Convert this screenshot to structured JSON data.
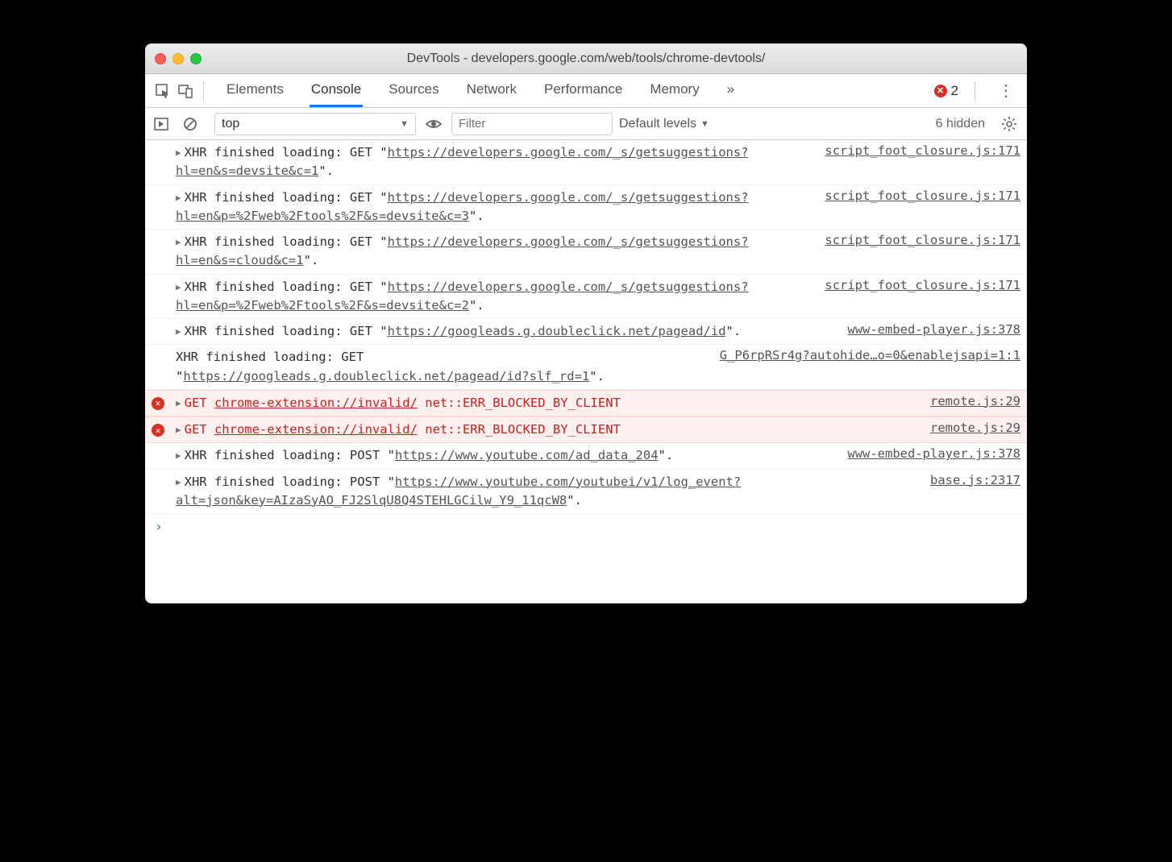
{
  "window": {
    "title": "DevTools - developers.google.com/web/tools/chrome-devtools/"
  },
  "tabs": {
    "items": [
      "Elements",
      "Console",
      "Sources",
      "Network",
      "Performance",
      "Memory"
    ],
    "activeIndex": 1,
    "overflow": "»",
    "errorCount": "2"
  },
  "filterbar": {
    "context": "top",
    "contextArrow": "▼",
    "filterPlaceholder": "Filter",
    "levels": "Default levels",
    "levelsArrow": "▼",
    "hidden": "6 hidden"
  },
  "rows": [
    {
      "type": "xhr",
      "prefix": "XHR finished loading: GET \"",
      "url": "https://developers.google.com/_s/getsuggestions?hl=en&s=devsite&c=1",
      "suffix": "\".",
      "src": "script_foot_closure.js:171",
      "expand": true
    },
    {
      "type": "xhr",
      "prefix": "XHR finished loading: GET \"",
      "url": "https://developers.google.com/_s/getsuggestions?hl=en&p=%2Fweb%2Ftools%2F&s=devsite&c=3",
      "suffix": "\".",
      "src": "script_foot_closure.js:171",
      "expand": true
    },
    {
      "type": "xhr",
      "prefix": "XHR finished loading: GET \"",
      "url": "https://developers.google.com/_s/getsuggestions?hl=en&s=cloud&c=1",
      "suffix": "\".",
      "src": "script_foot_closure.js:171",
      "expand": true
    },
    {
      "type": "xhr",
      "prefix": "XHR finished loading: GET \"",
      "url": "https://developers.google.com/_s/getsuggestions?hl=en&p=%2Fweb%2Ftools%2F&s=devsite&c=2",
      "suffix": "\".",
      "src": "script_foot_closure.js:171",
      "expand": true
    },
    {
      "type": "xhr",
      "prefix": "XHR finished loading: GET \"",
      "url": "https://googleads.g.doubleclick.net/pagead/id",
      "suffix": "\".",
      "src": "www-embed-player.js:378",
      "expand": true
    },
    {
      "type": "xhr",
      "prefix": "XHR finished loading: GET \"",
      "url": "https://googleads.g.doubleclick.net/pagead/id?slf_rd=1",
      "suffix": "\".",
      "src": "G_P6rpRSr4g?autohide…o=0&enablejsapi=1:1",
      "expand": false
    },
    {
      "type": "error",
      "method": "GET",
      "url": "chrome-extension://invalid/",
      "err": "net::ERR_BLOCKED_BY_CLIENT",
      "src": "remote.js:29",
      "expand": true
    },
    {
      "type": "error",
      "method": "GET",
      "url": "chrome-extension://invalid/",
      "err": "net::ERR_BLOCKED_BY_CLIENT",
      "src": "remote.js:29",
      "expand": true
    },
    {
      "type": "xhr",
      "prefix": "XHR finished loading: POST \"",
      "url": "https://www.youtube.com/ad_data_204",
      "suffix": "\".",
      "src": "www-embed-player.js:378",
      "expand": true
    },
    {
      "type": "xhr",
      "prefix": "XHR finished loading: POST \"",
      "url": "https://www.youtube.com/youtubei/v1/log_event?alt=json&key=AIzaSyAO_FJ2SlqU8Q4STEHLGCilw_Y9_11qcW8",
      "suffix": "\".",
      "src": "base.js:2317",
      "expand": true
    }
  ],
  "prompt": "›"
}
